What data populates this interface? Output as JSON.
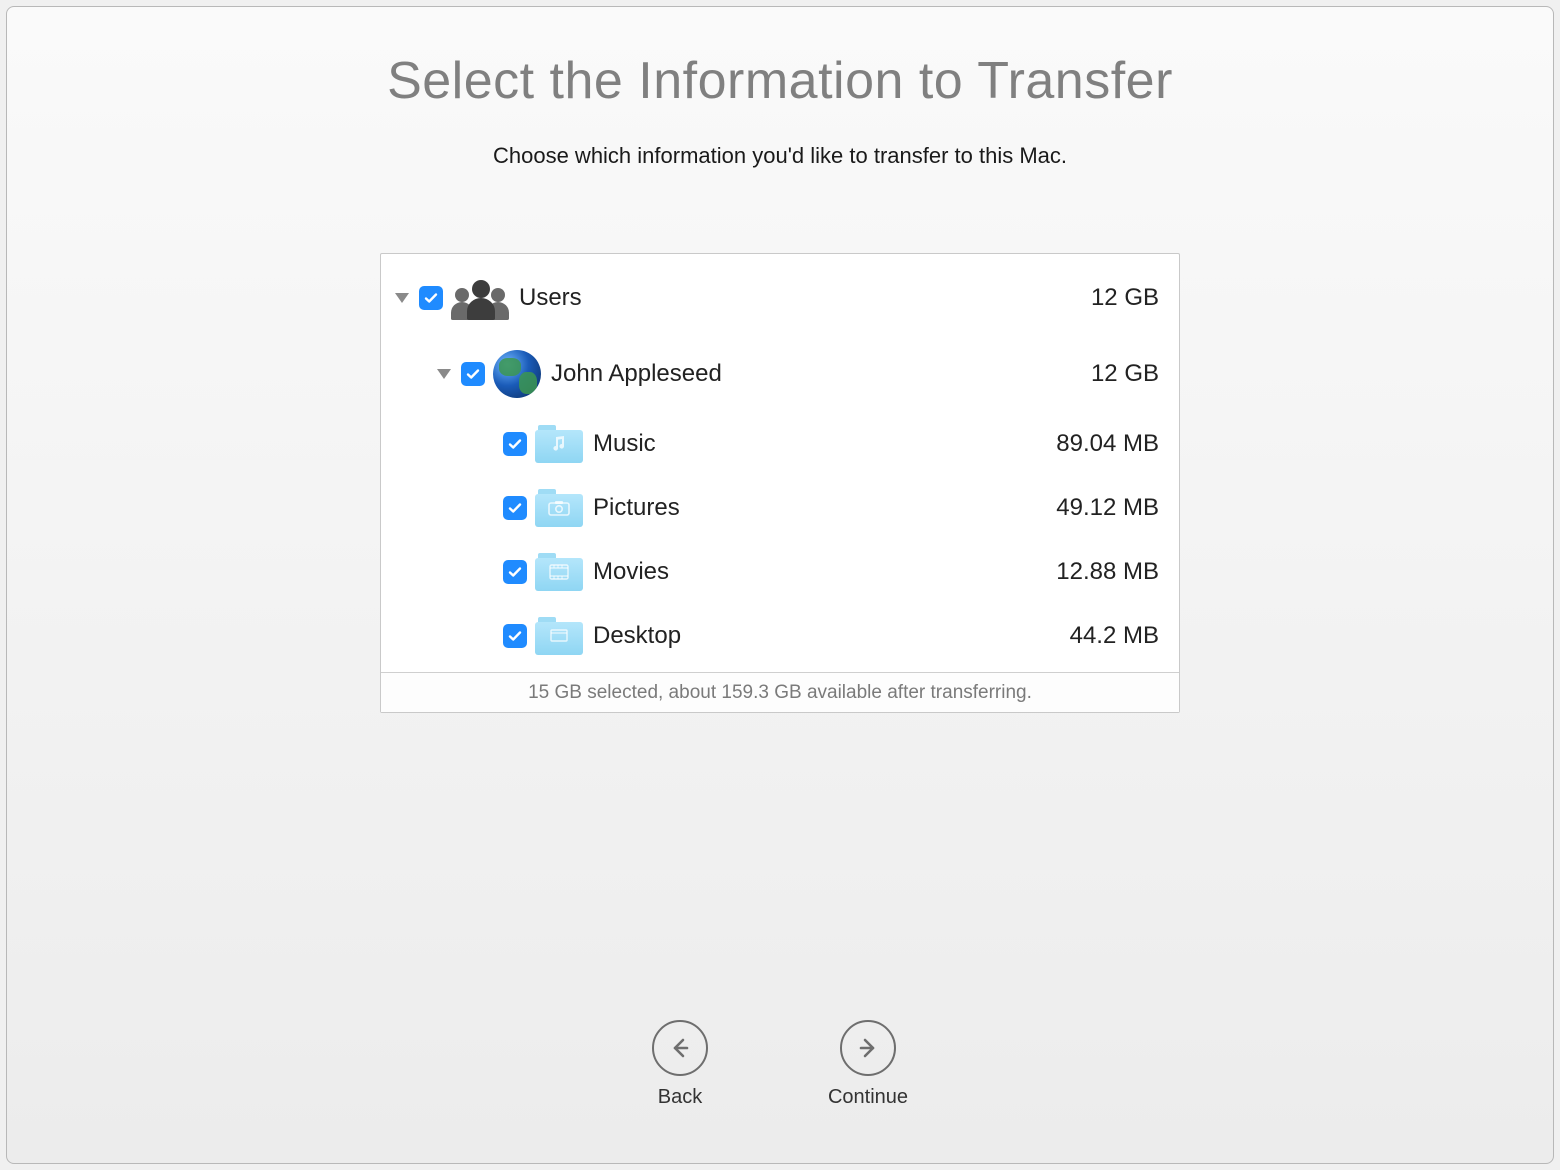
{
  "header": {
    "title": "Select the Information to Transfer",
    "subtitle": "Choose which information you'd like to transfer to this Mac."
  },
  "tree": {
    "root": {
      "label": "Users",
      "size": "12 GB",
      "checked": true,
      "expanded": true
    },
    "user": {
      "label": "John Appleseed",
      "size": "12 GB",
      "checked": true,
      "expanded": true
    },
    "items": [
      {
        "label": "Music",
        "size": "89.04 MB",
        "icon": "music-folder",
        "checked": true
      },
      {
        "label": "Pictures",
        "size": "49.12 MB",
        "icon": "pictures-folder",
        "checked": true
      },
      {
        "label": "Movies",
        "size": "12.88 MB",
        "icon": "movies-folder",
        "checked": true
      },
      {
        "label": "Desktop",
        "size": "44.2 MB",
        "icon": "desktop-folder",
        "checked": true
      }
    ]
  },
  "status": "15 GB selected, about 159.3 GB available after transferring.",
  "nav": {
    "back": "Back",
    "continue": "Continue"
  }
}
